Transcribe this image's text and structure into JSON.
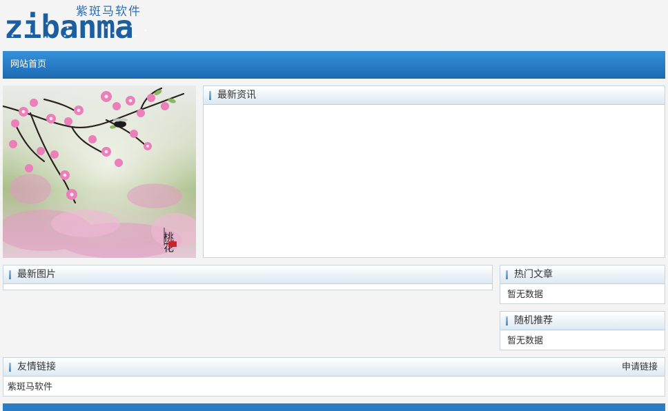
{
  "logo": {
    "cn_text": "紫斑马软件",
    "en_text": "zibanma"
  },
  "nav": {
    "items": [
      {
        "label": "网站首页"
      }
    ]
  },
  "hero": {
    "image": "peach-blossom-painting",
    "seal_text": "桃花"
  },
  "news": {
    "title": "最新资讯"
  },
  "pictures": {
    "title": "最新图片"
  },
  "hot": {
    "title": "热门文章",
    "empty": "暂无数据"
  },
  "random": {
    "title": "随机推荐",
    "empty": "暂无数据"
  },
  "links": {
    "title": "友情链接",
    "apply_label": "申请链接",
    "items": [
      "紫斑马软件"
    ]
  },
  "colors": {
    "nav": "#1c6cb5",
    "accent": "#2a7cc6",
    "logo": "#1d5e9e"
  }
}
